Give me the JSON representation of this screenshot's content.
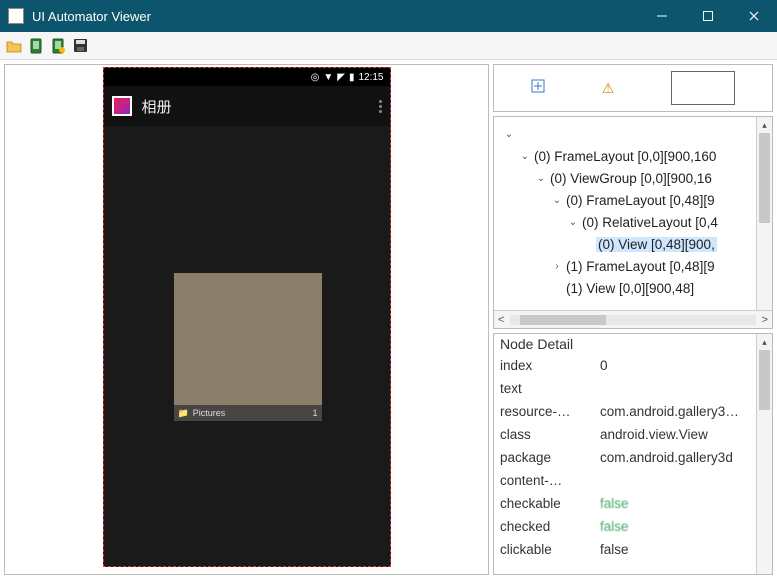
{
  "titlebar": {
    "title": "UI Automator Viewer"
  },
  "device": {
    "status_time": "12:15",
    "appbar_title": "相册",
    "album_label": "Pictures",
    "album_count": "1"
  },
  "tree": {
    "rows": [
      {
        "indent": 0,
        "caret": "v",
        "text": "",
        "selected": false
      },
      {
        "indent": 1,
        "caret": "v",
        "text": "(0) FrameLayout [0,0][900,160",
        "selected": false
      },
      {
        "indent": 2,
        "caret": "v",
        "text": "(0) ViewGroup [0,0][900,16",
        "selected": false
      },
      {
        "indent": 3,
        "caret": "v",
        "text": "(0) FrameLayout [0,48][9",
        "selected": false
      },
      {
        "indent": 4,
        "caret": "v",
        "text": "(0) RelativeLayout [0,4",
        "selected": false
      },
      {
        "indent": 5,
        "caret": "",
        "text": "(0) View [0,48][900,",
        "selected": true
      },
      {
        "indent": 3,
        "caret": ">",
        "text": "(1) FrameLayout [0,48][9",
        "selected": false
      },
      {
        "indent": 3,
        "caret": "",
        "text": "(1) View [0,0][900,48]",
        "selected": false
      }
    ]
  },
  "detail": {
    "title": "Node Detail",
    "rows": [
      {
        "key": "index",
        "val": "0"
      },
      {
        "key": "text",
        "val": ""
      },
      {
        "key": "resource-…",
        "val": "com.android.gallery3…"
      },
      {
        "key": "class",
        "val": "android.view.View"
      },
      {
        "key": "package",
        "val": "com.android.gallery3d"
      },
      {
        "key": "content-…",
        "val": ""
      },
      {
        "key": "checkable",
        "val": "false"
      },
      {
        "key": "checked",
        "val": "false"
      },
      {
        "key": "clickable",
        "val": "false"
      }
    ]
  }
}
